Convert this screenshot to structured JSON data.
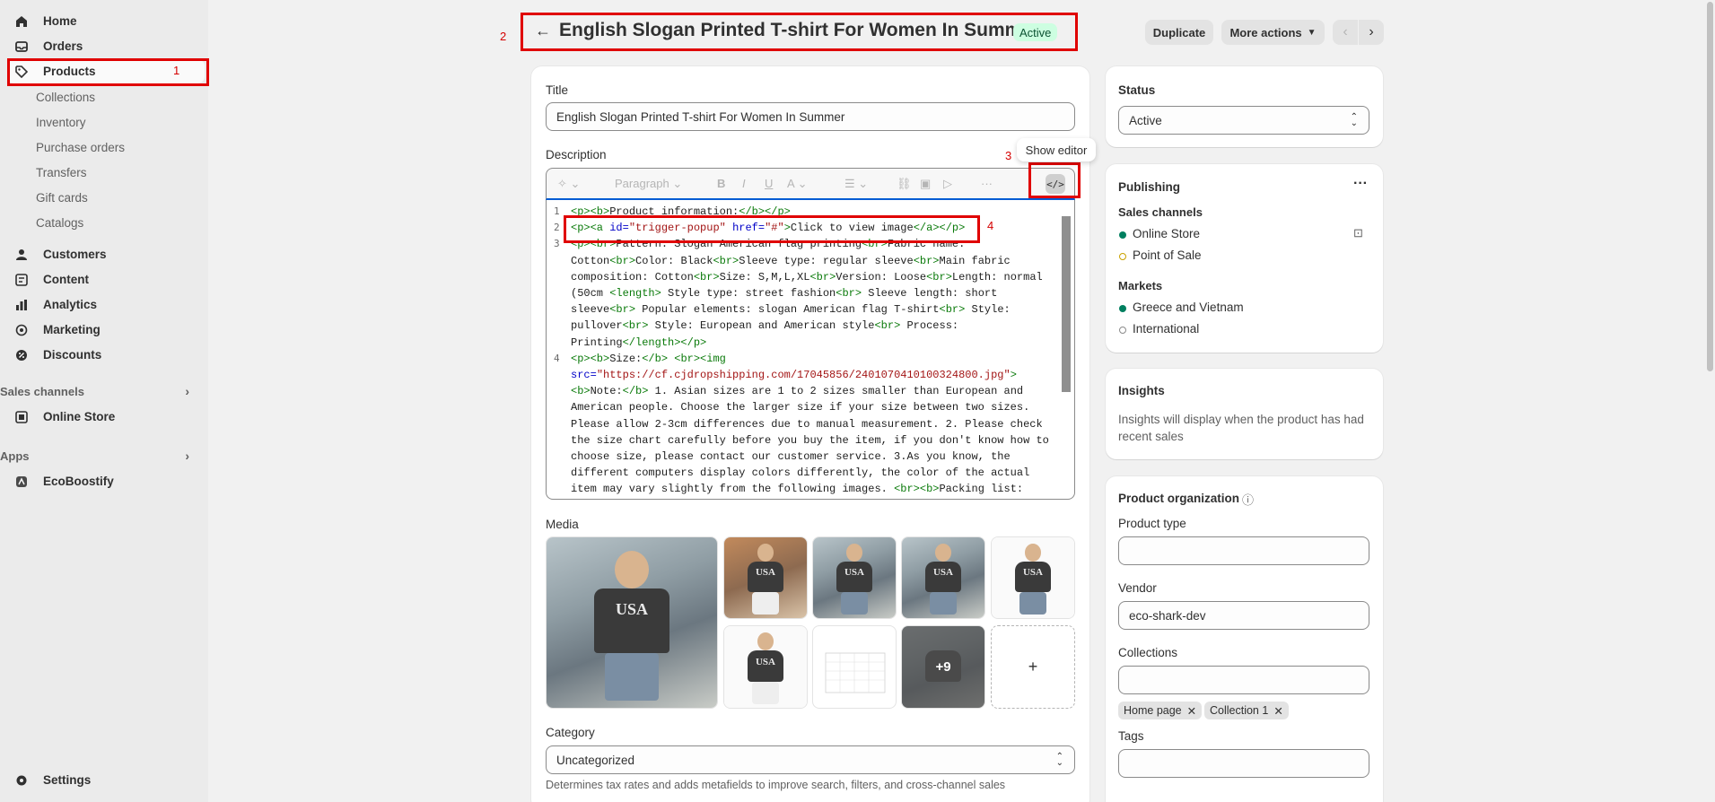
{
  "sidebar": {
    "items": [
      {
        "label": "Home",
        "icon": "home-icon"
      },
      {
        "label": "Orders",
        "icon": "inbox-icon"
      },
      {
        "label": "Products",
        "icon": "tag-icon"
      },
      {
        "label": "Customers",
        "icon": "person-icon"
      },
      {
        "label": "Content",
        "icon": "content-icon"
      },
      {
        "label": "Analytics",
        "icon": "bar-chart-icon"
      },
      {
        "label": "Marketing",
        "icon": "target-icon"
      },
      {
        "label": "Discounts",
        "icon": "discount-icon"
      }
    ],
    "product_subitems": [
      "Collections",
      "Inventory",
      "Purchase orders",
      "Transfers",
      "Gift cards",
      "Catalogs"
    ],
    "sales_channels_label": "Sales channels",
    "online_store": "Online Store",
    "apps_label": "Apps",
    "app_item": "EcoBoostify",
    "settings": "Settings"
  },
  "header": {
    "title": "English Slogan Printed T-shirt For Women In Summer",
    "status": "Active",
    "duplicate": "Duplicate",
    "more_actions": "More actions"
  },
  "main": {
    "title_label": "Title",
    "title_value": "English Slogan Printed T-shirt For Women In Summer",
    "description_label": "Description",
    "paragraph_select": "Paragraph",
    "tooltip": "Show editor",
    "media_label": "Media",
    "media_more": "+9",
    "media_add": "+",
    "category_label": "Category",
    "category_value": "Uncategorized",
    "category_help": "Determines tax rates and adds metafields to improve search, filters, and cross-channel sales",
    "code_lines": [
      "1",
      "2",
      "3",
      "4"
    ]
  },
  "right": {
    "status_label": "Status",
    "status_value": "Active",
    "publishing_label": "Publishing",
    "sales_channels_label": "Sales channels",
    "channels": [
      "Online Store",
      "Point of Sale"
    ],
    "markets_label": "Markets",
    "markets": [
      "Greece and Vietnam",
      "International"
    ],
    "insights_label": "Insights",
    "insights_text": "Insights will display when the product has had recent sales",
    "org_label": "Product organization",
    "product_type_label": "Product type",
    "vendor_label": "Vendor",
    "vendor_value": "eco-shark-dev",
    "collections_label": "Collections",
    "collection_chips": [
      "Home page",
      "Collection 1"
    ],
    "tags_label": "Tags"
  },
  "annotations": [
    "1",
    "2",
    "3",
    "4"
  ],
  "colors": {
    "annotation": "#e00000",
    "active_badge": "#cdfee1",
    "online_dot": "#007f5f",
    "pos_dot": "#c9a200"
  }
}
